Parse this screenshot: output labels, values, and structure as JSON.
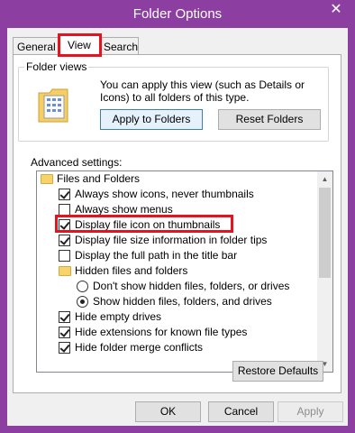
{
  "window": {
    "title": "Folder Options",
    "close_glyph": "✕"
  },
  "tabs": [
    {
      "label": "General"
    },
    {
      "label": "View"
    },
    {
      "label": "Search"
    }
  ],
  "folder_views": {
    "title": "Folder views",
    "description": "You can apply this view (such as Details or Icons) to all folders of this type.",
    "apply_label": "Apply to Folders",
    "reset_label": "Reset Folders"
  },
  "advanced": {
    "label": "Advanced settings:",
    "items": [
      {
        "label": "Files and Folders",
        "kind": "folder"
      },
      {
        "label": "Always show icons, never thumbnails",
        "kind": "checkbox",
        "checked": true
      },
      {
        "label": "Always show menus",
        "kind": "checkbox",
        "checked": false
      },
      {
        "label": "Display file icon on thumbnails",
        "kind": "checkbox",
        "checked": true
      },
      {
        "label": "Display file size information in folder tips",
        "kind": "checkbox",
        "checked": true
      },
      {
        "label": "Display the full path in the title bar",
        "kind": "checkbox",
        "checked": false
      },
      {
        "label": "Hidden files and folders",
        "kind": "folder"
      },
      {
        "label": "Don't show hidden files, folders, or drives",
        "kind": "radio",
        "checked": false
      },
      {
        "label": "Show hidden files, folders, and drives",
        "kind": "radio",
        "checked": true
      },
      {
        "label": "Hide empty drives",
        "kind": "checkbox",
        "checked": true
      },
      {
        "label": "Hide extensions for known file types",
        "kind": "checkbox",
        "checked": true
      },
      {
        "label": "Hide folder merge conflicts",
        "kind": "checkbox",
        "checked": true
      }
    ],
    "restore_label": "Restore Defaults"
  },
  "footer": {
    "ok_label": "OK",
    "cancel_label": "Cancel",
    "apply_label": "Apply"
  },
  "colors": {
    "titlebar": "#8c3fa0",
    "highlight": "#e3141f"
  }
}
